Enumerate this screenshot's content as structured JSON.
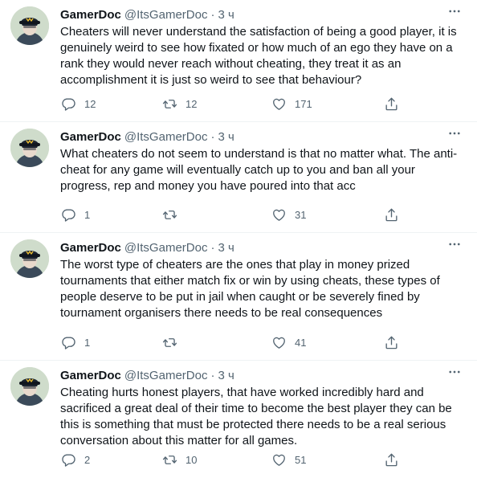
{
  "colors": {
    "text": "#0f1419",
    "secondary": "#536471",
    "divider": "#eff3f4",
    "icon": "#536471"
  },
  "icons": {
    "more": "more-horizontal-icon",
    "reply": "reply-bubble-icon",
    "retweet": "retweet-arrows-icon",
    "like": "heart-outline-icon",
    "share": "share-upload-icon"
  },
  "tweets": [
    {
      "author_name": "GamerDoc",
      "handle": "@ItsGamerDoc",
      "separator": "·",
      "time": "3 ч",
      "text": "Cheaters will never understand the satisfaction of being a good player, it is genuinely weird to see how fixated or how much of an ego they have on a rank they would never reach without cheating, they treat it as an accomplishment it is just so weird to see that behaviour?",
      "replies": "12",
      "retweets": "12",
      "likes": "171"
    },
    {
      "author_name": "GamerDoc",
      "handle": "@ItsGamerDoc",
      "separator": "·",
      "time": "3 ч",
      "text": "What cheaters do not seem to understand is that no matter what. The anti-cheat for any game will eventually catch up to you and ban all your progress, rep and money you have poured into that acc",
      "replies": "1",
      "retweets": "",
      "likes": "31"
    },
    {
      "author_name": "GamerDoc",
      "handle": "@ItsGamerDoc",
      "separator": "·",
      "time": "3 ч",
      "text": "The worst type of cheaters are the ones that play in money prized tournaments that either match fix or win by using cheats, these types of people deserve to be put in jail when caught or be severely fined by tournament organisers there needs to be real consequences",
      "replies": "1",
      "retweets": "",
      "likes": "41"
    },
    {
      "author_name": "GamerDoc",
      "handle": "@ItsGamerDoc",
      "separator": "·",
      "time": "3 ч",
      "text": "Cheating hurts honest players, that have worked incredibly hard and sacrificed a great deal of their time to become the best player they can be this is something that must be protected there needs to be a real serious conversation about this matter for all games.",
      "replies": "2",
      "retweets": "10",
      "likes": "51"
    }
  ]
}
